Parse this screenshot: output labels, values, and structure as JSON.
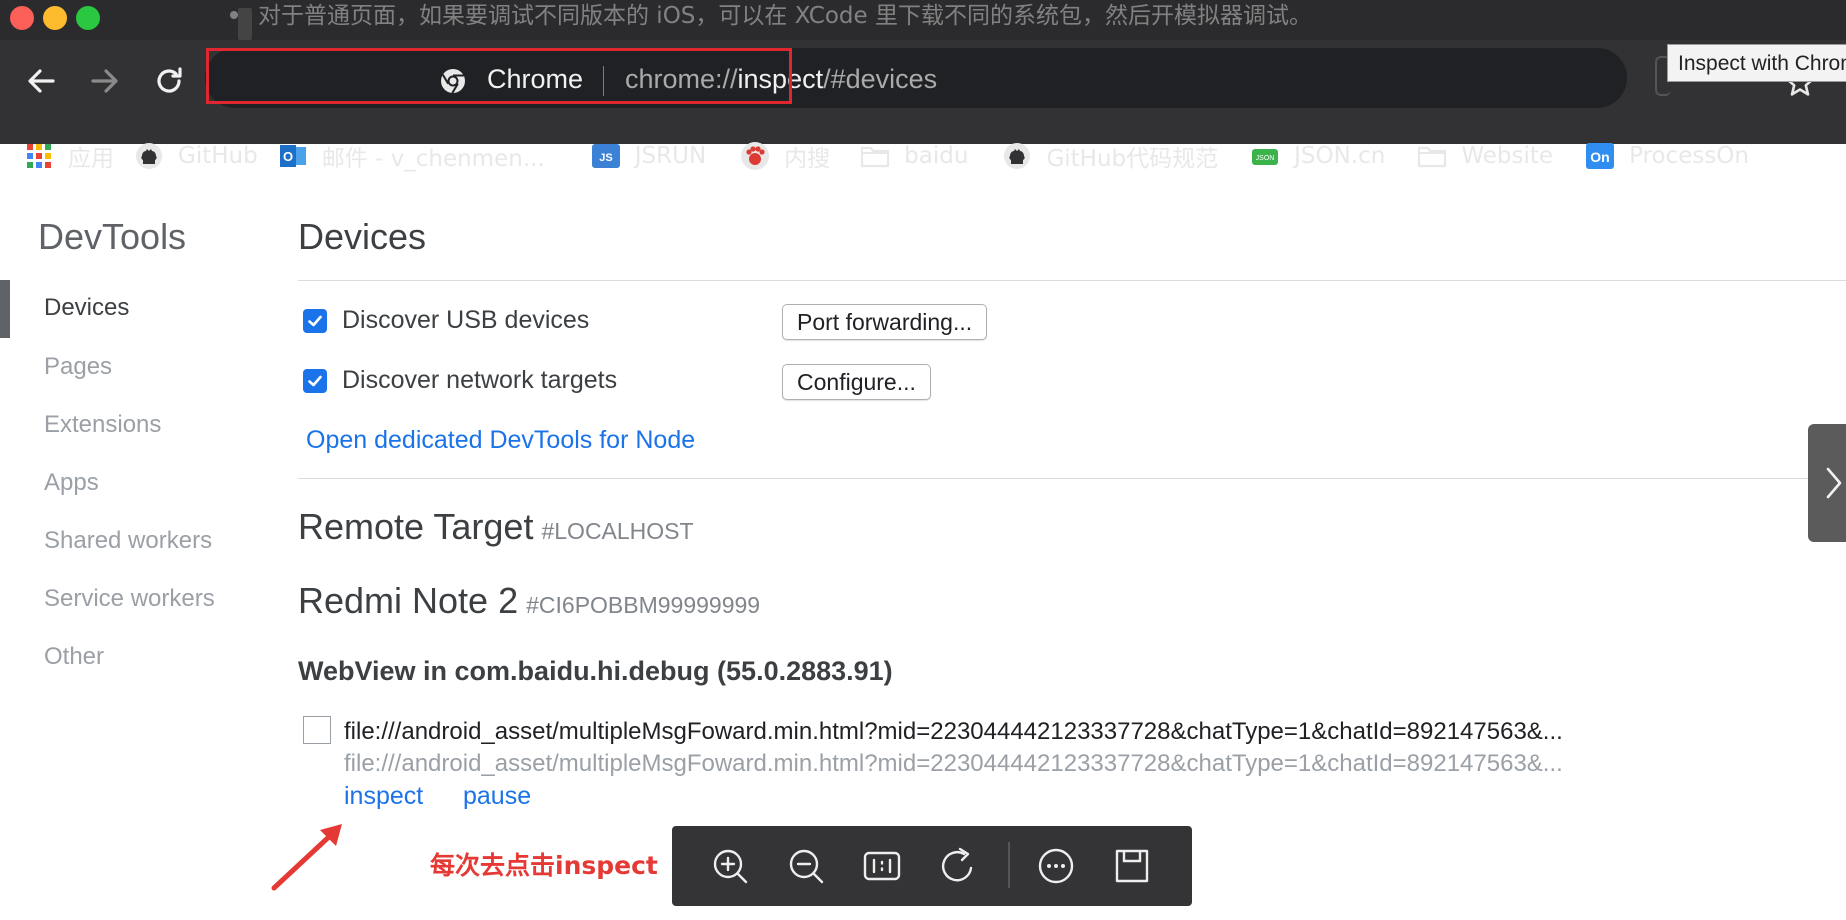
{
  "background_doc": {
    "bullet_text": "对于普通页面，如果要调试不同版本的 iOS，可以在 XCode 里下载不同的系统包，然后开模拟器调试。"
  },
  "toolbar": {
    "omnibox": {
      "site_label": "Chrome",
      "url_scheme": "chrome://",
      "url_host": "inspect",
      "url_rest": "/#devices"
    },
    "tooltip": "Inspect with Chrome Developer Tools"
  },
  "bookmarks": [
    {
      "label": "应用",
      "icon": "apps-grid-icon"
    },
    {
      "label": "GitHub",
      "icon": "github-icon"
    },
    {
      "label": "邮件 - v_chenmen...",
      "icon": "outlook-icon"
    },
    {
      "label": "JSRUN",
      "icon": "jsrun-icon"
    },
    {
      "label": "内搜",
      "icon": "baidu-paw-icon"
    },
    {
      "label": "baidu",
      "icon": "folder-icon"
    },
    {
      "label": "GitHub代码规范",
      "icon": "github-icon"
    },
    {
      "label": "JSON.cn",
      "icon": "json-icon"
    },
    {
      "label": "Website",
      "icon": "folder-icon"
    },
    {
      "label": "ProcessOn",
      "icon": "processon-icon"
    }
  ],
  "sidebar": {
    "title": "DevTools",
    "items": [
      {
        "label": "Devices",
        "active": true
      },
      {
        "label": "Pages"
      },
      {
        "label": "Extensions"
      },
      {
        "label": "Apps"
      },
      {
        "label": "Shared workers"
      },
      {
        "label": "Service workers"
      },
      {
        "label": "Other"
      }
    ]
  },
  "main": {
    "title": "Devices",
    "options": [
      {
        "label": "Discover USB devices",
        "checked": true,
        "button": "Port forwarding..."
      },
      {
        "label": "Discover network targets",
        "checked": true,
        "button": "Configure..."
      }
    ],
    "node_link": "Open dedicated DevTools for Node",
    "remote": {
      "title": "Remote Target",
      "sub": "#LOCALHOST"
    },
    "device": {
      "title": "Redmi Note 2",
      "sub": "#CI6POBBM99999999"
    },
    "webview_title": "WebView in com.baidu.hi.debug (55.0.2883.91)",
    "target": {
      "title": "file:///android_asset/multipleMsgFoward.min.html?mid=223044442123337728&chatType=1&chatId=892147563&...",
      "url": "file:///android_asset/multipleMsgFoward.min.html?mid=223044442123337728&chatType=1&chatId=892147563&...",
      "actions": [
        "inspect",
        "pause"
      ]
    }
  },
  "annotation": {
    "text": "每次去点击inspect",
    "color": "#e53935"
  },
  "viewer_toolbar": [
    {
      "icon": "zoom-in-icon"
    },
    {
      "icon": "zoom-out-icon"
    },
    {
      "icon": "actual-size-icon"
    },
    {
      "icon": "rotate-icon"
    },
    {
      "icon": "more-icon"
    },
    {
      "icon": "save-icon"
    }
  ],
  "colors": {
    "accent": "#1a73e8",
    "highlight": "#e0262f"
  }
}
